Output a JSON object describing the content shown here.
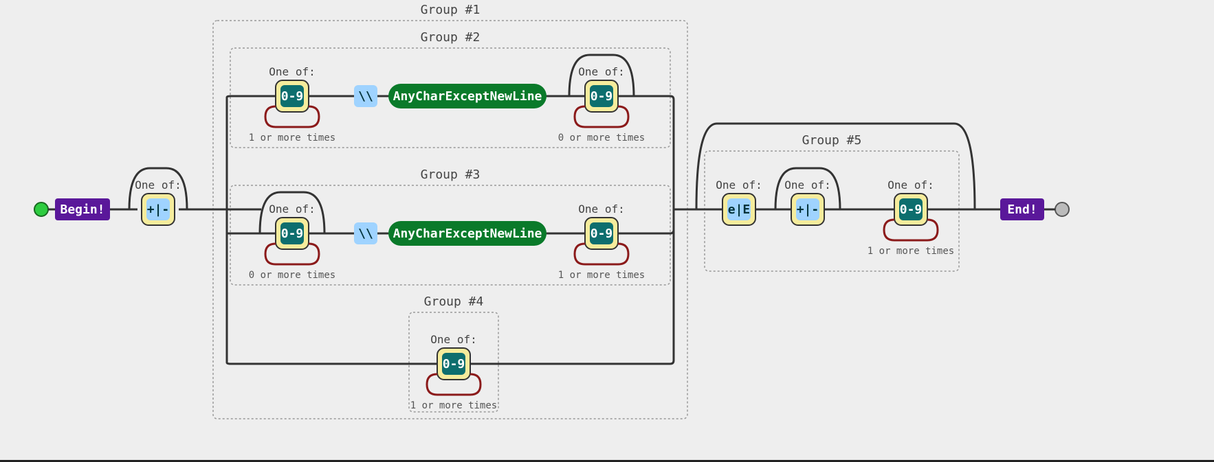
{
  "labels": {
    "begin": "Begin!",
    "end": "End!",
    "one_of": "One of:",
    "anychar": "AnyCharExceptNewLine",
    "bs": "\\\\",
    "r09": "0-9",
    "pm": "+|-",
    "eE": "e|E",
    "g1": "Group #1",
    "g2": "Group #2",
    "g3": "Group #3",
    "g4": "Group #4",
    "g5": "Group #5",
    "one_more": "1 or more times",
    "zero_more": "0 or more times"
  }
}
